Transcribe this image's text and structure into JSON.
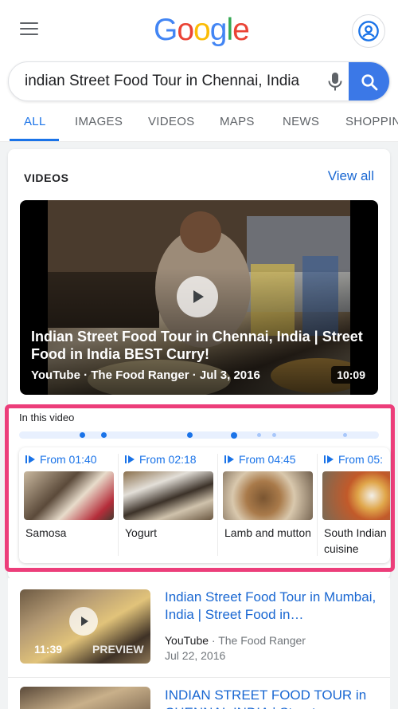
{
  "header": {
    "logo_letters": [
      {
        "char": "G",
        "color": "#4285F4"
      },
      {
        "char": "o",
        "color": "#EA4335"
      },
      {
        "char": "o",
        "color": "#FBBC05"
      },
      {
        "char": "g",
        "color": "#4285F4"
      },
      {
        "char": "l",
        "color": "#34A853"
      },
      {
        "char": "e",
        "color": "#EA4335"
      }
    ],
    "menu_icon": "hamburger-menu-icon",
    "account_icon": "account-circle-icon"
  },
  "search": {
    "query": "indian Street Food Tour in Chennai, India",
    "mic_icon": "microphone-icon",
    "submit_icon": "search-icon"
  },
  "tabs": [
    {
      "label": "ALL",
      "active": true
    },
    {
      "label": "IMAGES",
      "active": false
    },
    {
      "label": "VIDEOS",
      "active": false
    },
    {
      "label": "MAPS",
      "active": false
    },
    {
      "label": "NEWS",
      "active": false
    },
    {
      "label": "SHOPPING",
      "active": false
    }
  ],
  "videos_card": {
    "title": "VIDEOS",
    "view_all": "View all",
    "featured": {
      "title": "Indian Street Food Tour in Chennai, India | Street Food in India BEST Curry!",
      "meta": "YouTube · The Food Ranger · Jul 3, 2016",
      "duration": "10:09"
    },
    "in_this_video": "In this video",
    "chapters": [
      {
        "time": "From 01:40",
        "label": "Samosa"
      },
      {
        "time": "From 02:18",
        "label": "Yogurt"
      },
      {
        "time": "From 04:45",
        "label": "Lamb and mutton"
      },
      {
        "time": "From 05:",
        "label": "South Indian cuisine"
      }
    ]
  },
  "results": [
    {
      "title": "Indian Street Food Tour in Mumbai, India | Street Food in…",
      "source": "YouTube",
      "channel": "· The Food Ranger",
      "date": "Jul 22, 2016",
      "duration": "11:39",
      "badge": "PREVIEW"
    },
    {
      "title": "INDIAN STREET FOOD TOUR in CHENNAI, INDIA | Street"
    }
  ],
  "colors": {
    "accent": "#1a73e8",
    "highlight_border": "#ec3e7a",
    "search_button": "#3b78e7"
  }
}
